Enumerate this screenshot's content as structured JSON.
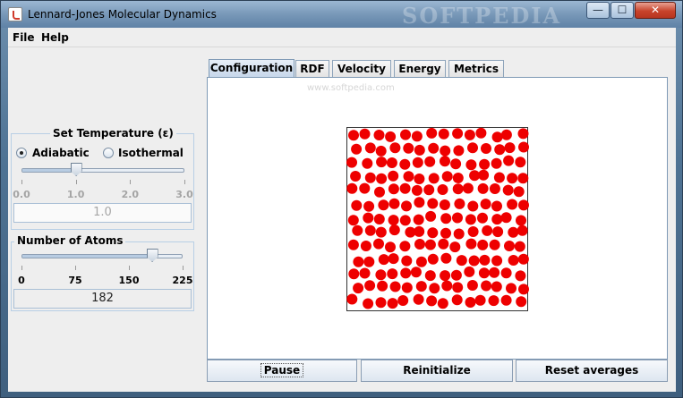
{
  "window": {
    "title": "Lennard-Jones Molecular Dynamics",
    "watermark": "SOFTPEDIA",
    "controls": {
      "minimize": "—",
      "maximize": "☐",
      "close": "✕"
    }
  },
  "menu": {
    "file": "File",
    "help": "Help"
  },
  "temperature": {
    "title": "Set Temperature (ε)",
    "adiabatic_label": "Adiabatic",
    "isothermal_label": "Isothermal",
    "mode": "Adiabatic",
    "ticks": [
      "0.0",
      "1.0",
      "2.0",
      "3.0"
    ],
    "slider_value": 1.0,
    "slider_range": [
      0.0,
      3.0
    ],
    "value": "1.0"
  },
  "atoms": {
    "title": "Number of Atoms",
    "ticks": [
      "0",
      "75",
      "150",
      "225"
    ],
    "slider_value": 182,
    "slider_range": [
      0,
      225
    ],
    "value": "182"
  },
  "tabs": {
    "configuration": "Configuration",
    "rdf": "RDF",
    "velocity": "Velocity",
    "energy": "Energy",
    "metrics": "Metrics",
    "active": "Configuration"
  },
  "canvas": {
    "watermark": "www.softpedia.com",
    "atom_color": "#ee0000",
    "atom_count": 182
  },
  "actions": {
    "pause": "Pause",
    "reinitialize": "Reinitialize",
    "reset": "Reset averages"
  }
}
